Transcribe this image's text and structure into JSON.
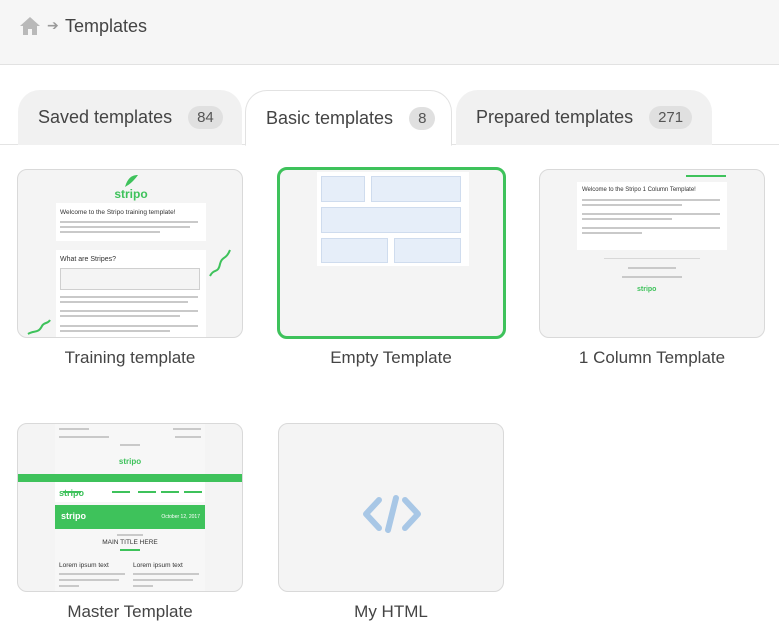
{
  "breadcrumb": {
    "title": "Templates"
  },
  "tabs": [
    {
      "label": "Saved templates",
      "count": "84"
    },
    {
      "label": "Basic templates",
      "count": "8"
    },
    {
      "label": "Prepared templates",
      "count": "271"
    }
  ],
  "cards": [
    {
      "label": "Training template",
      "heading1": "Welcome to the Stripo training template!",
      "heading2": "What are Stripes?"
    },
    {
      "label": "Empty Template"
    },
    {
      "label": "1 Column Template",
      "heading1": "Welcome to the Stripo 1 Column Template!"
    },
    {
      "label": "Master Template",
      "subtitle": "MAIN TITLE HERE",
      "col1": "Lorem ipsum text",
      "col2": "Lorem ipsum text",
      "date": "October 12, 2017"
    },
    {
      "label": "My HTML"
    }
  ],
  "brand": {
    "logo_text": "stripo",
    "accent": "#3ec25b",
    "code_icon_color": "#a8c7e6"
  }
}
